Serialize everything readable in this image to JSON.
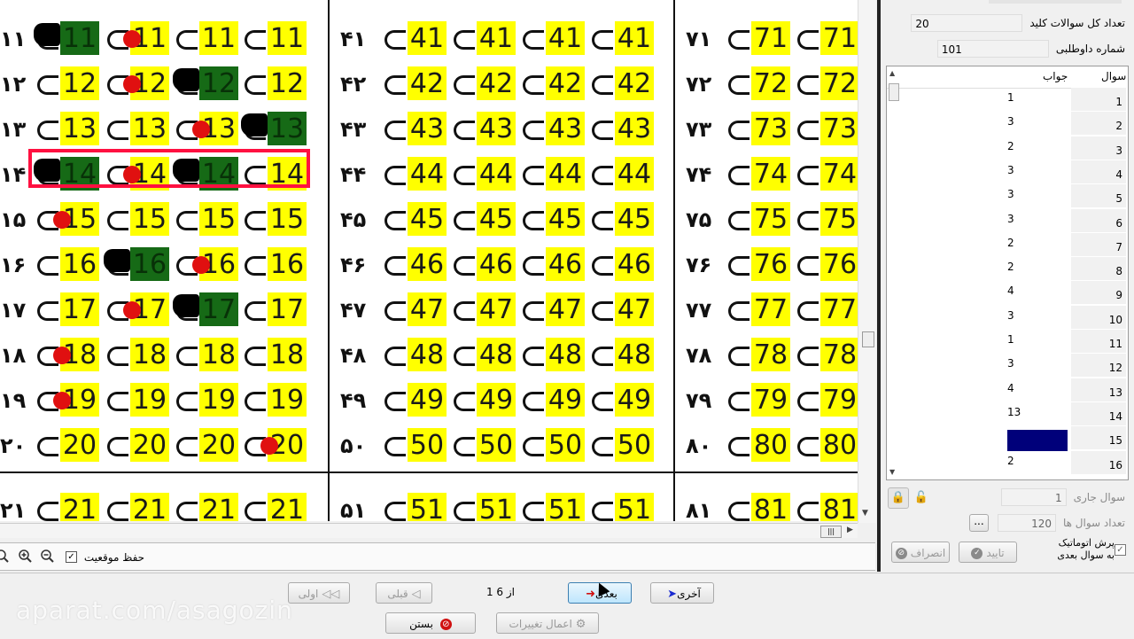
{
  "sheet": {
    "column_a": {
      "marks": [
        "١١",
        "١٢",
        "١٣",
        "١۴",
        "١۵",
        "١۶",
        "١٧",
        "١٨",
        "١٩",
        "٢٠"
      ],
      "rows": [
        [
          "11",
          "11",
          "11",
          "11"
        ],
        [
          "12",
          "12",
          "12",
          "12"
        ],
        [
          "13",
          "13",
          "13",
          "13"
        ],
        [
          "14",
          "14",
          "14",
          "14"
        ],
        [
          "15",
          "15",
          "15",
          "15"
        ],
        [
          "16",
          "16",
          "16",
          "16"
        ],
        [
          "17",
          "17",
          "17",
          "17"
        ],
        [
          "18",
          "18",
          "18",
          "18"
        ],
        [
          "19",
          "19",
          "19",
          "19"
        ],
        [
          "20",
          "20",
          "20",
          "20"
        ]
      ]
    },
    "column_b": {
      "marks": [
        "۴١",
        "۴٢",
        "۴٣",
        "۴۴",
        "۴۵",
        "۴۶",
        "۴٧",
        "۴٨",
        "۴٩",
        "۵٠"
      ],
      "rows": [
        [
          "41",
          "41",
          "41",
          "41"
        ],
        [
          "42",
          "42",
          "42",
          "42"
        ],
        [
          "43",
          "43",
          "43",
          "43"
        ],
        [
          "44",
          "44",
          "44",
          "44"
        ],
        [
          "45",
          "45",
          "45",
          "45"
        ],
        [
          "46",
          "46",
          "46",
          "46"
        ],
        [
          "47",
          "47",
          "47",
          "47"
        ],
        [
          "48",
          "48",
          "48",
          "48"
        ],
        [
          "49",
          "49",
          "49",
          "49"
        ],
        [
          "50",
          "50",
          "50",
          "50"
        ]
      ]
    },
    "column_c": {
      "marks": [
        "٧١",
        "٧٢",
        "٧٣",
        "٧۴",
        "٧۵",
        "٧۶",
        "٧٧",
        "٧٨",
        "٧٩",
        "٨٠"
      ],
      "rows": [
        [
          "71",
          "71"
        ],
        [
          "72",
          "72"
        ],
        [
          "73",
          "73"
        ],
        [
          "74",
          "74"
        ],
        [
          "75",
          "75"
        ],
        [
          "76",
          "76"
        ],
        [
          "77",
          "77"
        ],
        [
          "78",
          "78"
        ],
        [
          "79",
          "79"
        ],
        [
          "80",
          "80"
        ]
      ]
    },
    "bottom_row": {
      "marks": [
        "٢١",
        "۵١",
        "٨١"
      ],
      "a": [
        "21",
        "21",
        "21",
        "21"
      ],
      "b": [
        "51",
        "51",
        "51",
        "51"
      ],
      "c": [
        "81",
        "81"
      ]
    }
  },
  "sheet_toolbar": {
    "keep_position_label": "حفظ موقعیت",
    "keep_position_checked": "✓"
  },
  "right_panel": {
    "total_key_questions_label": "تعداد کل سوالات کلید",
    "total_key_questions_value": "20",
    "candidate_number_label": "شماره داوطلبی",
    "candidate_number_value": "101",
    "grid": {
      "col_question": "سوال",
      "col_answer": "جواب",
      "rows": [
        {
          "q": "1",
          "a": "1"
        },
        {
          "q": "2",
          "a": "3"
        },
        {
          "q": "3",
          "a": "2"
        },
        {
          "q": "4",
          "a": "3"
        },
        {
          "q": "5",
          "a": "3"
        },
        {
          "q": "6",
          "a": "3"
        },
        {
          "q": "7",
          "a": "2"
        },
        {
          "q": "8",
          "a": "2"
        },
        {
          "q": "9",
          "a": "4"
        },
        {
          "q": "10",
          "a": "3"
        },
        {
          "q": "11",
          "a": "1"
        },
        {
          "q": "12",
          "a": "3"
        },
        {
          "q": "13",
          "a": "4"
        },
        {
          "q": "14",
          "a": "13"
        },
        {
          "q": "15",
          "a": ""
        },
        {
          "q": "16",
          "a": "2"
        }
      ],
      "highlight_color": "#00007a"
    },
    "current_question_label": "سوال جاری",
    "current_question_value": "1",
    "question_count_label": "تعداد سوال ها",
    "question_count_value": "120",
    "browse_label": "...",
    "auto_jump_label_1": "پرش اتوماتیک",
    "auto_jump_label_2": "به سوال بعدی",
    "auto_jump_checked": "✓",
    "confirm_label": "تایید",
    "cancel_label": "انصراف"
  },
  "bottom_nav": {
    "first_label": "اولی",
    "prev_label": "قبلی",
    "page_indicator": "1 از 6",
    "next_label": "بعدی",
    "last_label": "آخری",
    "apply_label": "اعمال تغییرات",
    "close_label": "بستن"
  },
  "watermark": "aparat.com/asagozin",
  "colors": {
    "answer_cell": "#ffff00",
    "filled_cell": "#1a7d1a",
    "selection": "#ff1040",
    "red_mark": "#e01010"
  }
}
